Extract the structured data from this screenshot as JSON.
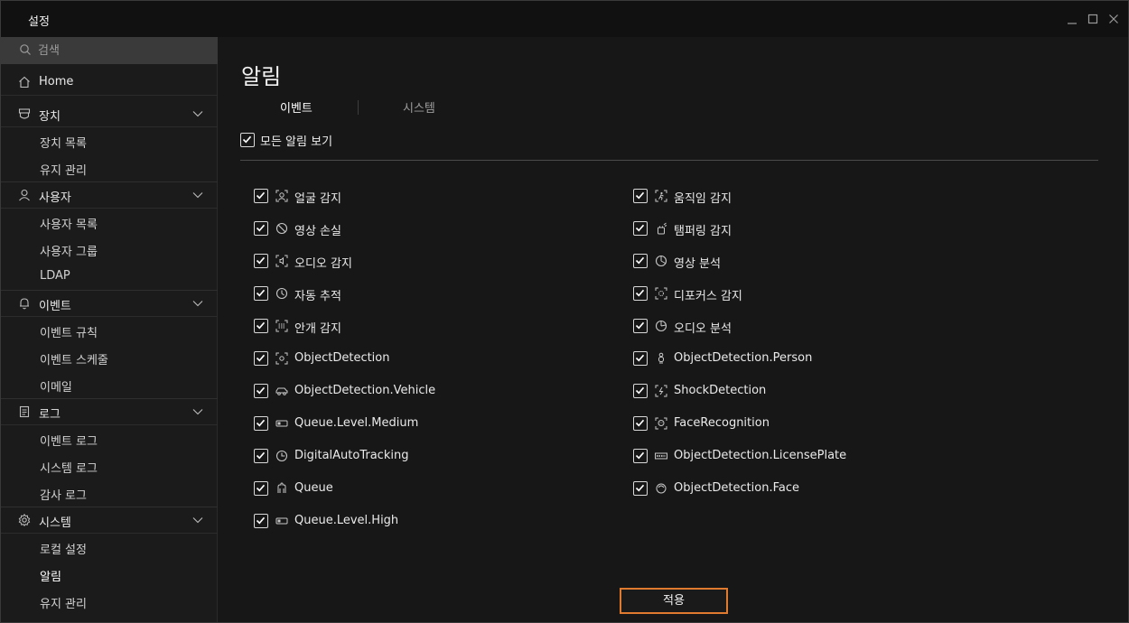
{
  "window": {
    "title": "설정"
  },
  "sidebar": {
    "search_placeholder": "검색",
    "home": "Home",
    "groups": [
      {
        "label": "장치",
        "items": [
          "장치 목록",
          "유지 관리"
        ]
      },
      {
        "label": "사용자",
        "items": [
          "사용자 목록",
          "사용자 그룹",
          "LDAP"
        ]
      },
      {
        "label": "이벤트",
        "items": [
          "이벤트 규칙",
          "이벤트 스케줄",
          "이메일"
        ]
      },
      {
        "label": "로그",
        "items": [
          "이벤트 로그",
          "시스템 로그",
          "감사 로그"
        ]
      },
      {
        "label": "시스템",
        "items": [
          "로컬 설정",
          "알림",
          "유지 관리"
        ]
      }
    ],
    "active_item": "알림"
  },
  "main": {
    "title": "알림",
    "tabs": [
      {
        "label": "이벤트",
        "active": true
      },
      {
        "label": "시스템",
        "active": false
      }
    ],
    "show_all": {
      "label": "모든 알림 보기",
      "checked": true
    },
    "left_column": [
      {
        "label": "얼굴 감지",
        "icon": "face-detect-icon",
        "checked": true
      },
      {
        "label": "영상 손실",
        "icon": "video-loss-icon",
        "checked": true
      },
      {
        "label": "오디오 감지",
        "icon": "audio-detect-icon",
        "checked": true
      },
      {
        "label": "자동 추적",
        "icon": "auto-tracking-icon",
        "checked": true
      },
      {
        "label": "안개 감지",
        "icon": "fog-detect-icon",
        "checked": true
      },
      {
        "label": "ObjectDetection",
        "icon": "object-detect-icon",
        "checked": true
      },
      {
        "label": "ObjectDetection.Vehicle",
        "icon": "vehicle-icon",
        "checked": true
      },
      {
        "label": "Queue.Level.Medium",
        "icon": "queue-level-icon",
        "checked": true
      },
      {
        "label": "DigitalAutoTracking",
        "icon": "digital-tracking-icon",
        "checked": true
      },
      {
        "label": "Queue",
        "icon": "queue-icon",
        "checked": true
      },
      {
        "label": "Queue.Level.High",
        "icon": "queue-level-icon",
        "checked": true
      }
    ],
    "right_column": [
      {
        "label": "움직임 감지",
        "icon": "motion-detect-icon",
        "checked": true
      },
      {
        "label": "탬퍼링 감지",
        "icon": "tampering-icon",
        "checked": true
      },
      {
        "label": "영상 분석",
        "icon": "video-analytics-icon",
        "checked": true
      },
      {
        "label": "디포커스 감지",
        "icon": "defocus-icon",
        "checked": true
      },
      {
        "label": "오디오 분석",
        "icon": "audio-analytics-icon",
        "checked": true
      },
      {
        "label": "ObjectDetection.Person",
        "icon": "person-icon",
        "checked": true
      },
      {
        "label": "ShockDetection",
        "icon": "shock-icon",
        "checked": true
      },
      {
        "label": "FaceRecognition",
        "icon": "face-recognition-icon",
        "checked": true
      },
      {
        "label": "ObjectDetection.LicensePlate",
        "icon": "license-plate-icon",
        "checked": true
      },
      {
        "label": "ObjectDetection.Face",
        "icon": "face-icon",
        "checked": true
      }
    ],
    "apply_label": "적용"
  },
  "colors": {
    "accent": "#e07a2e",
    "background": "#171717",
    "sidebar": "#1b1b1b"
  }
}
